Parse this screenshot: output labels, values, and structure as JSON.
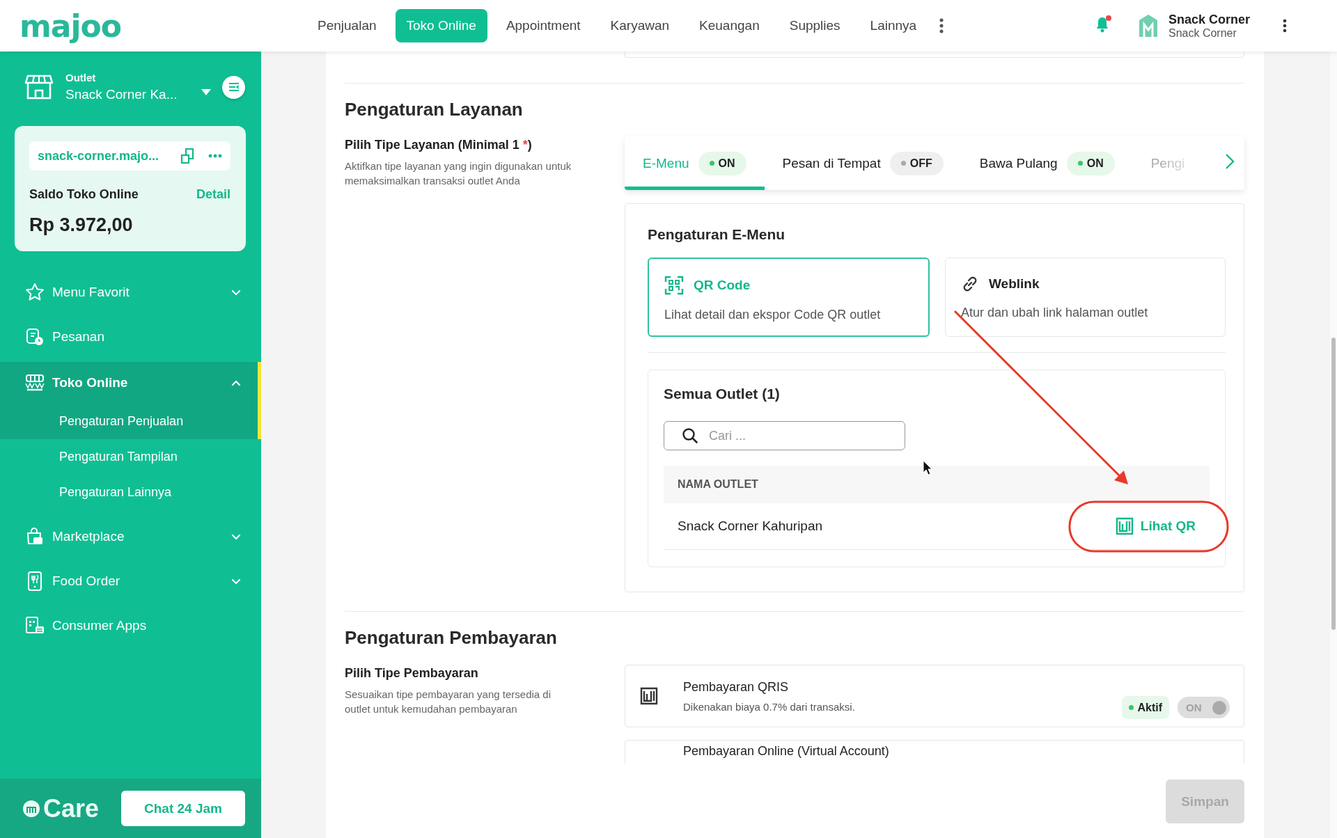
{
  "header": {
    "logo": "majoo",
    "nav": [
      {
        "label": "Penjualan",
        "selected": false
      },
      {
        "label": "Toko Online",
        "selected": true
      },
      {
        "label": "Appointment",
        "selected": false
      },
      {
        "label": "Karyawan",
        "selected": false
      },
      {
        "label": "Keuangan",
        "selected": false
      },
      {
        "label": "Supplies",
        "selected": false
      },
      {
        "label": "Lainnya",
        "selected": false
      }
    ],
    "notification_unread": true,
    "user": {
      "name": "Snack Corner",
      "subtitle": "Snack Corner"
    }
  },
  "sidebar": {
    "outlet": {
      "label": "Outlet",
      "name": "Snack Corner Ka..."
    },
    "store_card": {
      "link": "snack-corner.majo...",
      "balance_label": "Saldo Toko Online",
      "detail_link": "Detail",
      "balance": "Rp 3.972,00"
    },
    "items": [
      {
        "label": "Menu Favorit",
        "selected": false,
        "expanded": false
      },
      {
        "label": "Pesanan",
        "selected": false
      },
      {
        "label": "Toko Online",
        "selected": true,
        "expanded": true,
        "children": [
          {
            "label": "Pengaturan Penjualan",
            "selected": true
          },
          {
            "label": "Pengaturan Tampilan",
            "selected": false
          },
          {
            "label": "Pengaturan Lainnya",
            "selected": false
          }
        ]
      },
      {
        "label": "Marketplace",
        "selected": false,
        "expanded": false
      },
      {
        "label": "Food Order",
        "selected": false,
        "expanded": false
      },
      {
        "label": "Consumer Apps",
        "selected": false
      }
    ],
    "care": {
      "brand": "Care",
      "button": "Chat 24 Jam"
    }
  },
  "service_settings": {
    "title": "Pengaturan Layanan",
    "label_start": "Pilih Tipe Layanan (Minimal 1",
    "required_mark": "*",
    "label_end": ")",
    "description": "Aktifkan tipe layanan yang ingin digunakan untuk memaksimalkan transaksi outlet Anda",
    "tabs": [
      {
        "label": "E-Menu",
        "status": "ON",
        "on": true,
        "selected": true
      },
      {
        "label": "Pesan di Tempat",
        "status": "OFF",
        "on": false,
        "selected": false
      },
      {
        "label": "Bawa Pulang",
        "status": "ON",
        "on": true,
        "selected": false
      },
      {
        "label": "Pengi",
        "selected": false
      }
    ],
    "emenu": {
      "title": "Pengaturan E-Menu",
      "options": [
        {
          "title": "QR Code",
          "description": "Lihat detail dan ekspor Code QR outlet",
          "selected": true
        },
        {
          "title": "Weblink",
          "description": "Atur dan ubah link halaman outlet",
          "selected": false
        }
      ],
      "outlets": {
        "title": "Semua Outlet (1)",
        "search": {
          "placeholder": "Cari ..."
        },
        "columns": [
          "NAMA OUTLET"
        ],
        "rows": [
          {
            "name": "Snack Corner Kahuripan",
            "action": "Lihat QR"
          }
        ]
      }
    }
  },
  "payment_settings": {
    "title": "Pengaturan Pembayaran",
    "label": "Pilih Tipe Pembayaran",
    "description": "Sesuaikan tipe pembayaran yang tersedia di outlet untuk kemudahan pembayaran",
    "methods": [
      {
        "name": "Pembayaran QRIS",
        "description": "Dikenakan biaya 0.7% dari transaksi.",
        "status": "Aktif",
        "toggle": "ON",
        "on": true,
        "disabled": true
      },
      {
        "name": "Pembayaran Online (Virtual Account)"
      }
    ]
  },
  "save_button": {
    "label": "Simpan",
    "disabled": true
  },
  "annotation": {
    "kind": "arrow-to-circle"
  }
}
